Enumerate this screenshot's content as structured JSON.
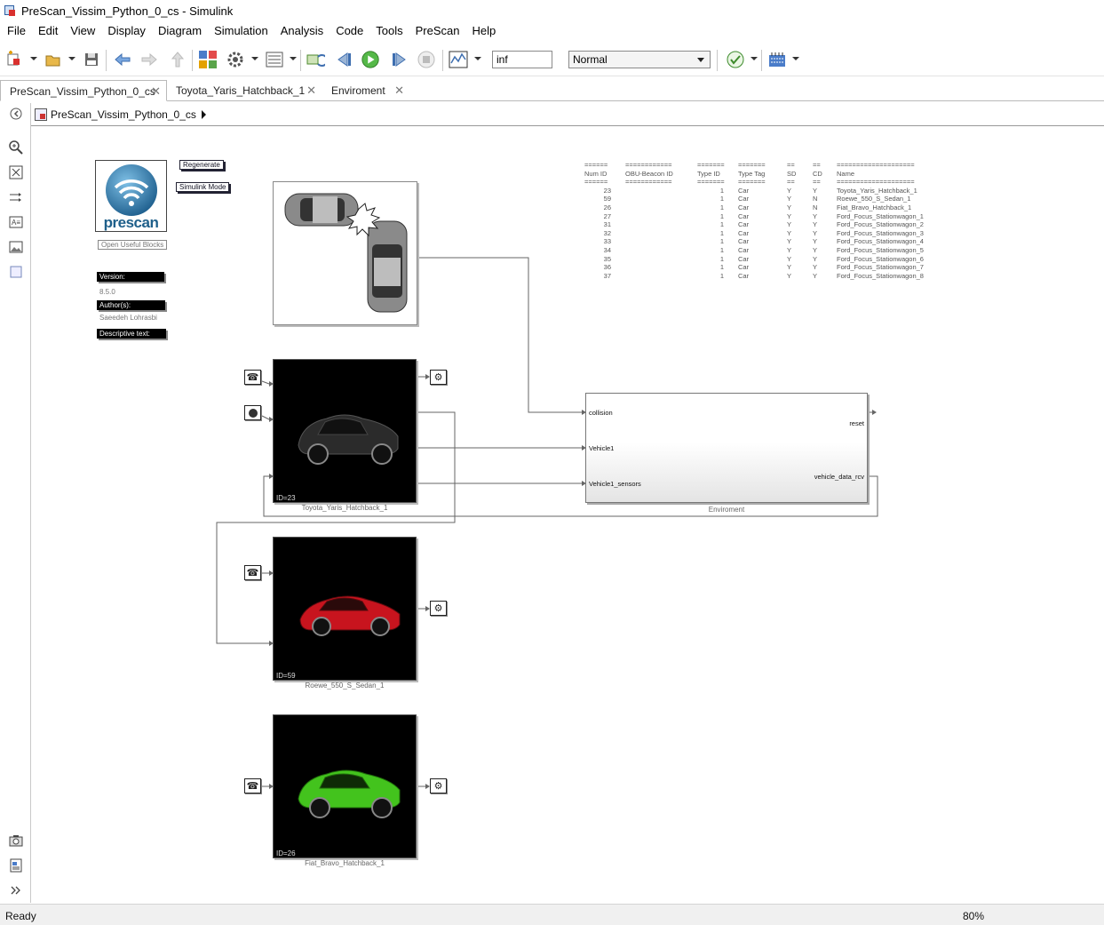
{
  "window": {
    "title": "PreScan_Vissim_Python_0_cs - Simulink"
  },
  "menu": [
    "File",
    "Edit",
    "View",
    "Display",
    "Diagram",
    "Simulation",
    "Analysis",
    "Code",
    "Tools",
    "PreScan",
    "Help"
  ],
  "toolbar": {
    "stop_time": "inf",
    "sim_mode": "Normal"
  },
  "tabs": [
    {
      "label": "PreScan_Vissim_Python_0_cs",
      "active": true
    },
    {
      "label": "Toyota_Yaris_Hatchback_1",
      "active": false
    },
    {
      "label": "Enviroment",
      "active": false
    }
  ],
  "breadcrumb": {
    "model": "PreScan_Vissim_Python_0_cs"
  },
  "canvas": {
    "logo": {
      "text": "prescan"
    },
    "regenerate_label": "Regenerate",
    "simulink_mode_label": "Simulink Mode",
    "open_blocks_label": "Open Useful Blocks",
    "version_label": "Version:",
    "version_value": "8.5.0",
    "authors_label": "Author(s):",
    "authors_value": "Saeedeh Lohrasbi",
    "descriptive_label": "Descriptive text:",
    "vehicles": [
      {
        "id_text": "ID=23",
        "label": "Toyota_Yaris_Hatchback_1",
        "color": "#2b2b2b"
      },
      {
        "id_text": "ID=59",
        "label": "Roewe_550_S_Sedan_1",
        "color": "#c8141e"
      },
      {
        "id_text": "ID=26",
        "label": "Fiat_Bravo_Hatchback_1",
        "color": "#43c31d"
      }
    ],
    "environment": {
      "label": "Enviroment",
      "inputs": [
        "collision",
        "Vehicle1",
        "Vehicle1_sensors"
      ],
      "outputs": [
        "reset",
        "vehicle_data_rcv"
      ]
    },
    "table": {
      "separator": [
        "======",
        "============",
        "=======",
        "=======",
        "==",
        "==",
        "===================="
      ],
      "header": [
        "Num ID",
        "OBU-Beacon ID",
        "Type ID",
        "Type Tag",
        "SD",
        "CD",
        "Name"
      ],
      "rows": [
        [
          "23",
          "",
          "1",
          "Car",
          "Y",
          "Y",
          "Toyota_Yaris_Hatchback_1"
        ],
        [
          "59",
          "",
          "1",
          "Car",
          "Y",
          "N",
          "Roewe_550_S_Sedan_1"
        ],
        [
          "26",
          "",
          "1",
          "Car",
          "Y",
          "N",
          "Fiat_Bravo_Hatchback_1"
        ],
        [
          "27",
          "",
          "1",
          "Car",
          "Y",
          "Y",
          "Ford_Focus_Stationwagon_1"
        ],
        [
          "31",
          "",
          "1",
          "Car",
          "Y",
          "Y",
          "Ford_Focus_Stationwagon_2"
        ],
        [
          "32",
          "",
          "1",
          "Car",
          "Y",
          "Y",
          "Ford_Focus_Stationwagon_3"
        ],
        [
          "33",
          "",
          "1",
          "Car",
          "Y",
          "Y",
          "Ford_Focus_Stationwagon_4"
        ],
        [
          "34",
          "",
          "1",
          "Car",
          "Y",
          "Y",
          "Ford_Focus_Stationwagon_5"
        ],
        [
          "35",
          "",
          "1",
          "Car",
          "Y",
          "Y",
          "Ford_Focus_Stationwagon_6"
        ],
        [
          "36",
          "",
          "1",
          "Car",
          "Y",
          "Y",
          "Ford_Focus_Stationwagon_7"
        ],
        [
          "37",
          "",
          "1",
          "Car",
          "Y",
          "Y",
          "Ford_Focus_Stationwagon_8"
        ]
      ]
    }
  },
  "status": {
    "left": "Ready",
    "zoom": "80%"
  },
  "icons": {
    "toolbar": [
      "new-model-icon",
      "open-icon",
      "save-icon",
      "back-icon",
      "forward-icon",
      "up-icon",
      "library-browser-icon",
      "model-config-icon",
      "model-explorer-icon",
      "update-diagram-icon",
      "step-back-icon",
      "run-icon",
      "step-forward-icon",
      "stop-icon",
      "scope-icon",
      "check-icon",
      "build-icon"
    ],
    "palette": [
      "hide-browser-icon",
      "zoom-icon",
      "fit-view-icon",
      "arrow-icon",
      "annotation-icon",
      "image-icon",
      "area-icon",
      "screenshot-icon",
      "report-icon",
      "expand-icon"
    ]
  }
}
